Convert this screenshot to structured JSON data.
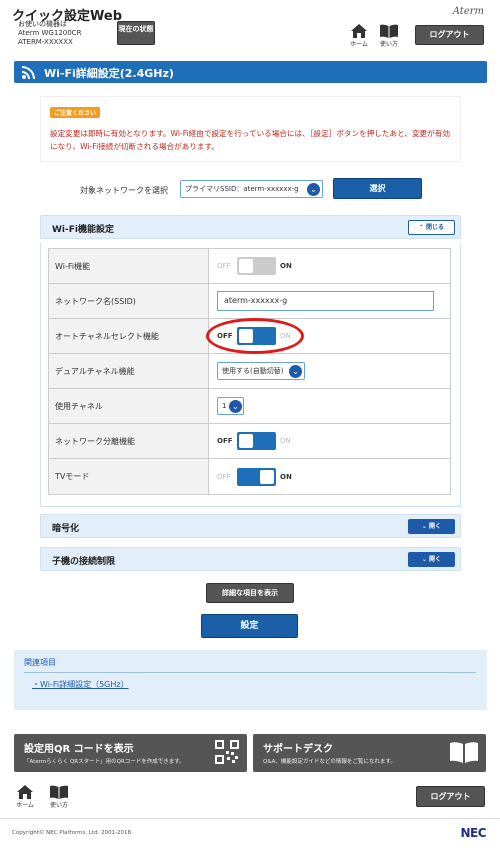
{
  "header": {
    "app_title": "クイック設定Web",
    "device_label": "お使いの機器は",
    "model": "Aterm WG1200CR",
    "ssid": "ATERM-XXXXXX",
    "status_button": "現在の状態",
    "brand": "Aterm",
    "home_label": "ホーム",
    "help_label": "使い方",
    "logout_label": "ログアウト"
  },
  "page_title": "Wi-Fi詳細設定(2.4GHz)",
  "notice": {
    "badge": "ご注意ください",
    "text": "設定変更は即時に有効となります。Wi-Fi経由で設定を行っている場合には、［設定］ボタンを押したあと、変更が有効になり、Wi-Fi接続が切断される場合があります。"
  },
  "network_select": {
    "label": "対象ネットワークを選択",
    "value": "プライマリSSID：aterm-xxxxxx-g",
    "button": "選択"
  },
  "wifi_panel": {
    "title": "Wi-Fi機能設定",
    "toggle": "閉じる",
    "rows": {
      "wifi": {
        "label": "Wi-Fi機能",
        "off": "OFF",
        "on": "ON"
      },
      "ssid": {
        "label": "ネットワーク名(SSID)",
        "value": "aterm-xxxxxx-g"
      },
      "auto_channel": {
        "label": "オートチャネルセレクト機能",
        "off": "OFF",
        "on": "ON"
      },
      "dual_channel": {
        "label": "デュアルチャネル機能",
        "value": "使用する(自動切替)"
      },
      "channel": {
        "label": "使用チャネル",
        "value": "1"
      },
      "separation": {
        "label": "ネットワーク分離機能",
        "off": "OFF",
        "on": "ON"
      },
      "tv_mode": {
        "label": "TVモード",
        "off": "OFF",
        "on": "ON"
      }
    }
  },
  "encryption_panel": {
    "title": "暗号化",
    "toggle": "開く"
  },
  "client_limit_panel": {
    "title": "子機の接続制限",
    "toggle": "開く"
  },
  "detail_button": "詳細な項目を表示",
  "save_button": "設定",
  "related": {
    "title": "関連項目",
    "link": "Wi-Fi詳細設定（5GHz）"
  },
  "qr_card": {
    "title": "設定用QR コードを表示",
    "subtitle": "「Atermらくらく QRスタート」用のQRコードを作成できます。"
  },
  "support_card": {
    "title": "サポートデスク",
    "subtitle": "Q&A、機能設定ガイドなどの情報をご覧になれます。"
  },
  "footer": {
    "home_label": "ホーム",
    "help_label": "使い方",
    "logout_label": "ログアウト",
    "copyright": "Copyright© NEC Platforms, Ltd. 2001-2018",
    "nec_logo": "NEC"
  },
  "colors": {
    "accent": "#1e6fb8",
    "toggle_on": "#1e6fb8",
    "toggle_off": "#cccccc",
    "notice_text": "#c0271e",
    "highlight_ring": "#e01a1a"
  }
}
